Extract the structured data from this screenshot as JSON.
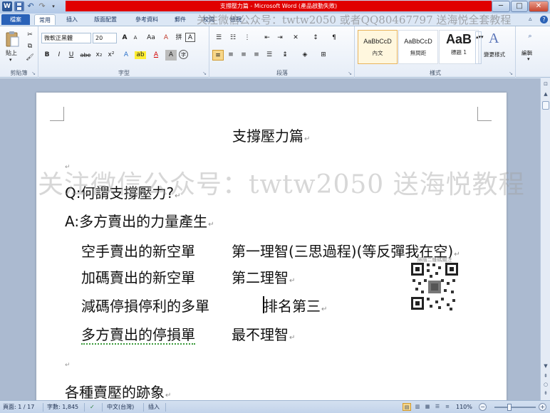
{
  "window": {
    "title": "支撐壓力篇 - Microsoft Word (產品啟動失敗)",
    "app_icon": "W",
    "minimize": "─",
    "maximize": "□",
    "close": "✕"
  },
  "quick_access": {
    "undo": "↶",
    "redo": "↷",
    "customize": "▾"
  },
  "tabs": [
    {
      "label": "檔案"
    },
    {
      "label": "常用"
    },
    {
      "label": "插入"
    },
    {
      "label": "版面配置"
    },
    {
      "label": "參考資料"
    },
    {
      "label": "郵件"
    },
    {
      "label": "校閱"
    },
    {
      "label": "檢視"
    }
  ],
  "watermark": {
    "top": "关注微信公众号：twtw2050 或者QQ80467797 送海悦全套教程",
    "middle": "关注微信公众号：twtw2050 送海悦教程"
  },
  "ribbon": {
    "clipboard": {
      "paste": "貼上",
      "label": "剪貼簿"
    },
    "font": {
      "name": "微軟正黑體",
      "size": "20",
      "grow": "A",
      "shrink": "A",
      "case": "Aa",
      "clear": "A",
      "bold": "B",
      "italic": "I",
      "underline": "U",
      "strike": "abe",
      "subscript": "x₂",
      "superscript": "x²",
      "effects": "A",
      "highlight": "ab",
      "color": "A",
      "shade": "A",
      "enclose": "字",
      "label": "字型"
    },
    "paragraph": {
      "label": "段落"
    },
    "styles": {
      "tiles": [
        {
          "sample": "AaBbCcD",
          "name": "內文",
          "selected": true
        },
        {
          "sample": "AaBbCcD",
          "name": "無間距",
          "selected": false
        },
        {
          "sample": "AaB",
          "name": "標題 1",
          "selected": false
        }
      ],
      "change": "變更樣式",
      "label": "樣式"
    },
    "editing": {
      "label": "編輯"
    }
  },
  "document": {
    "title": "支撐壓力篇",
    "question": "Q:何謂支撐壓力?",
    "answer": "A:多方賣出的力量產生",
    "rows": [
      {
        "left": "空手賣出的新空單",
        "right": "第一理智(三思過程)(等反彈我在空)"
      },
      {
        "left": "加碼賣出的新空單",
        "right": "第二理智"
      },
      {
        "left": "減碼停損停利的多單",
        "right": "排名第三"
      },
      {
        "left": "多方賣出的停損單",
        "right": "最不理智"
      }
    ],
    "heading2": "各種賣壓的跡象",
    "paragraph_mark": "↵"
  },
  "qr": {
    "caption": "掃描二維碼關注"
  },
  "status": {
    "page": "頁面: 1 / 17",
    "words": "字數: 1,845",
    "language": "中文(台灣)",
    "mode": "插入",
    "zoom": "110%",
    "zoom_minus": "−",
    "zoom_plus": "+"
  }
}
